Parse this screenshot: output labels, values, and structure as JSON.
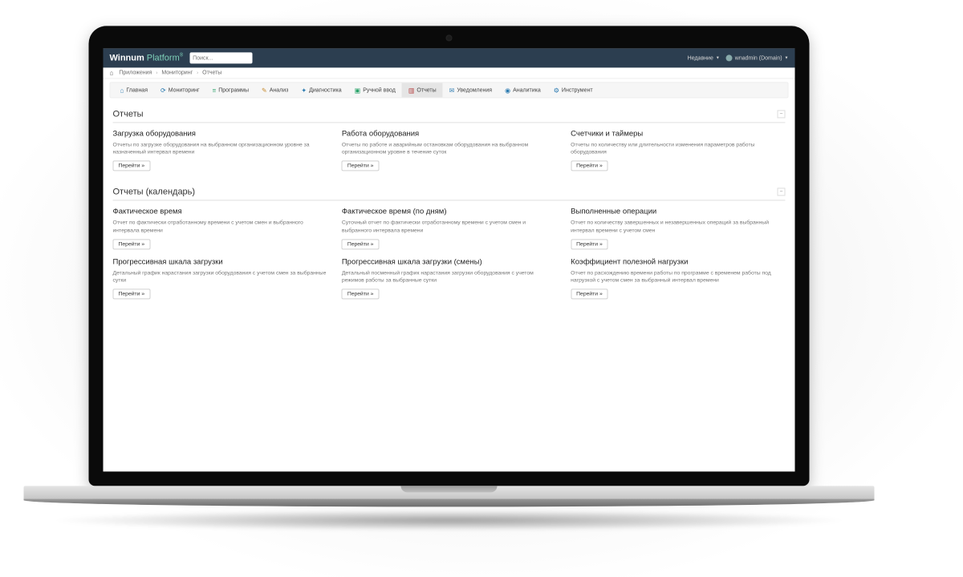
{
  "brand": {
    "name": "Winnum",
    "accent": "Platform",
    "reg": "®"
  },
  "search": {
    "placeholder": "Поиск..."
  },
  "top": {
    "recent": "Недавние",
    "user": "wnadmin (Domain)"
  },
  "breadcrumb": [
    {
      "label": "Приложения"
    },
    {
      "label": "Мониторинг"
    },
    {
      "label": "Отчеты"
    }
  ],
  "tabs": [
    {
      "icon": "⌂",
      "cls": "blue",
      "label": "Главная"
    },
    {
      "icon": "⟳",
      "cls": "blue",
      "label": "Мониторинг"
    },
    {
      "icon": "≡",
      "cls": "green",
      "label": "Программы"
    },
    {
      "icon": "✎",
      "cls": "orange",
      "label": "Анализ"
    },
    {
      "icon": "✦",
      "cls": "blue",
      "label": "Диагностика"
    },
    {
      "icon": "▣",
      "cls": "green",
      "label": "Ручной ввод"
    },
    {
      "icon": "▥",
      "cls": "red",
      "label": "Отчеты",
      "active": true
    },
    {
      "icon": "✉",
      "cls": "blue",
      "label": "Уведомления"
    },
    {
      "icon": "◉",
      "cls": "blue",
      "label": "Аналитика"
    },
    {
      "icon": "⚙",
      "cls": "blue",
      "label": "Инструмент"
    }
  ],
  "section1": {
    "title": "Отчеты"
  },
  "section2": {
    "title": "Отчеты (календарь)"
  },
  "go_label": "Перейти »",
  "cards1": [
    {
      "title": "Загрузка оборудования",
      "desc": "Отчеты по загрузке оборудования на выбранном организационном уровне за назначенный интервал времени"
    },
    {
      "title": "Работа оборудования",
      "desc": "Отчеты по работе и аварийным остановкам оборудования на выбранном организационном уровне в течение суток"
    },
    {
      "title": "Счетчики и таймеры",
      "desc": "Отчеты по количеству или длительности изменения параметров работы оборудования"
    }
  ],
  "cards2": [
    {
      "title": "Фактическое время",
      "desc": "Отчет по фактически отработанному времени с учетом смен и выбранного интервала времени"
    },
    {
      "title": "Фактическое время (по дням)",
      "desc": "Суточный отчет по фактически отработанному времени с учетом смен и выбранного интервала времени"
    },
    {
      "title": "Выполненные операции",
      "desc": "Отчет по количеству завершенных и незавершенных операций за выбранный интервал времени с учетом смен"
    },
    {
      "title": "Прогрессивная шкала загрузки",
      "desc": "Детальный график нарастания загрузки оборудования с учетом смен за выбранные сутки"
    },
    {
      "title": "Прогрессивная шкала загрузки (смены)",
      "desc": "Детальный посменный график нарастания загрузки оборудования с учетом режимов работы за выбранные сутки"
    },
    {
      "title": "Коэффициент полезной нагрузки",
      "desc": "Отчет по расхождению времени работы по программе с временем работы под нагрузкой с учетом смен за выбранный интервал времени"
    }
  ]
}
